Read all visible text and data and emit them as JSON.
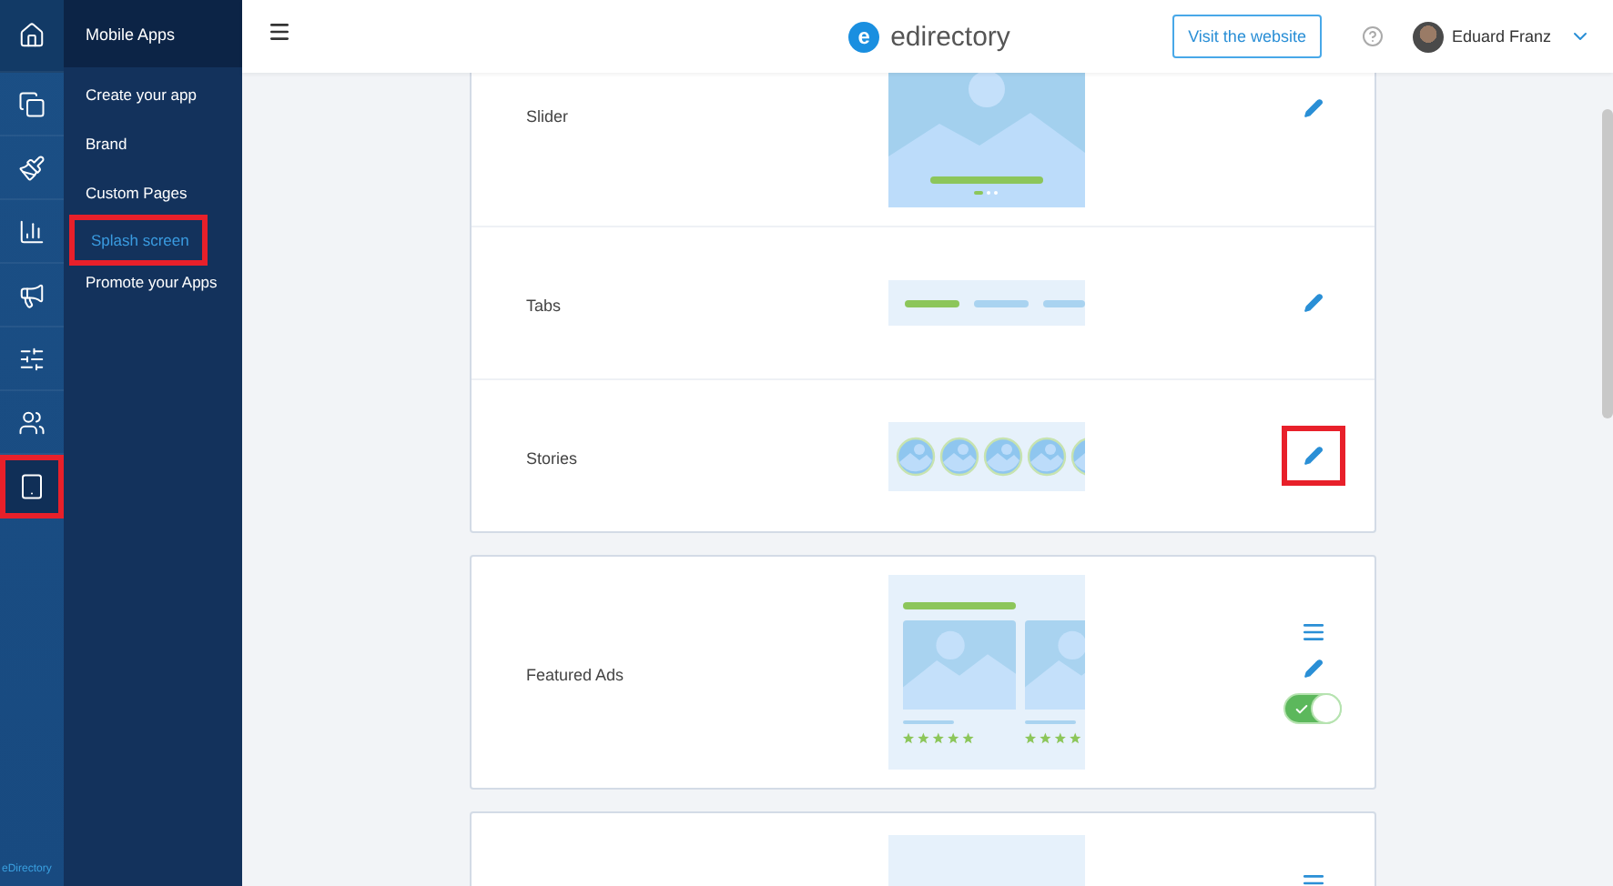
{
  "nav_icons": [
    {
      "kind": "home",
      "selected": false,
      "highlighted": false
    },
    {
      "kind": "copy",
      "selected": false,
      "highlighted": false
    },
    {
      "kind": "brush",
      "selected": false,
      "highlighted": false
    },
    {
      "kind": "chart",
      "selected": false,
      "highlighted": false
    },
    {
      "kind": "megaphone",
      "selected": false,
      "highlighted": false
    },
    {
      "kind": "sliders",
      "selected": false,
      "highlighted": false
    },
    {
      "kind": "users",
      "selected": false,
      "highlighted": false
    },
    {
      "kind": "tablet",
      "selected": true,
      "highlighted": true
    }
  ],
  "brand_footer": "eDirectory",
  "submenu": {
    "title": "Mobile Apps",
    "items": [
      {
        "label": "Create your app",
        "selected": false,
        "highlighted": false
      },
      {
        "label": "Brand",
        "selected": false,
        "highlighted": false
      },
      {
        "label": "Custom Pages",
        "selected": false,
        "highlighted": false
      },
      {
        "label": "Splash screen",
        "selected": true,
        "highlighted": true
      },
      {
        "label": "Promote your Apps",
        "selected": false,
        "highlighted": false
      }
    ]
  },
  "topbar": {
    "logo": "edirectory",
    "logo_letter": "e",
    "visit_button": "Visit the website",
    "user_name": "Eduard Franz"
  },
  "cards": [
    {
      "rows": [
        {
          "label": "Slider",
          "kind": "slider",
          "reorder": false,
          "edit_highlighted": false
        },
        {
          "label": "Tabs",
          "kind": "tabs",
          "reorder": false,
          "edit_highlighted": false
        },
        {
          "label": "Stories",
          "kind": "stories",
          "reorder": false,
          "edit_highlighted": true
        }
      ]
    },
    {
      "rows": [
        {
          "label": "Featured Ads",
          "kind": "featured",
          "reorder": true,
          "edit_highlighted": false,
          "toggle_on": true
        }
      ]
    },
    {
      "rows": [
        {
          "kind": "banner",
          "reorder": true
        }
      ]
    }
  ]
}
